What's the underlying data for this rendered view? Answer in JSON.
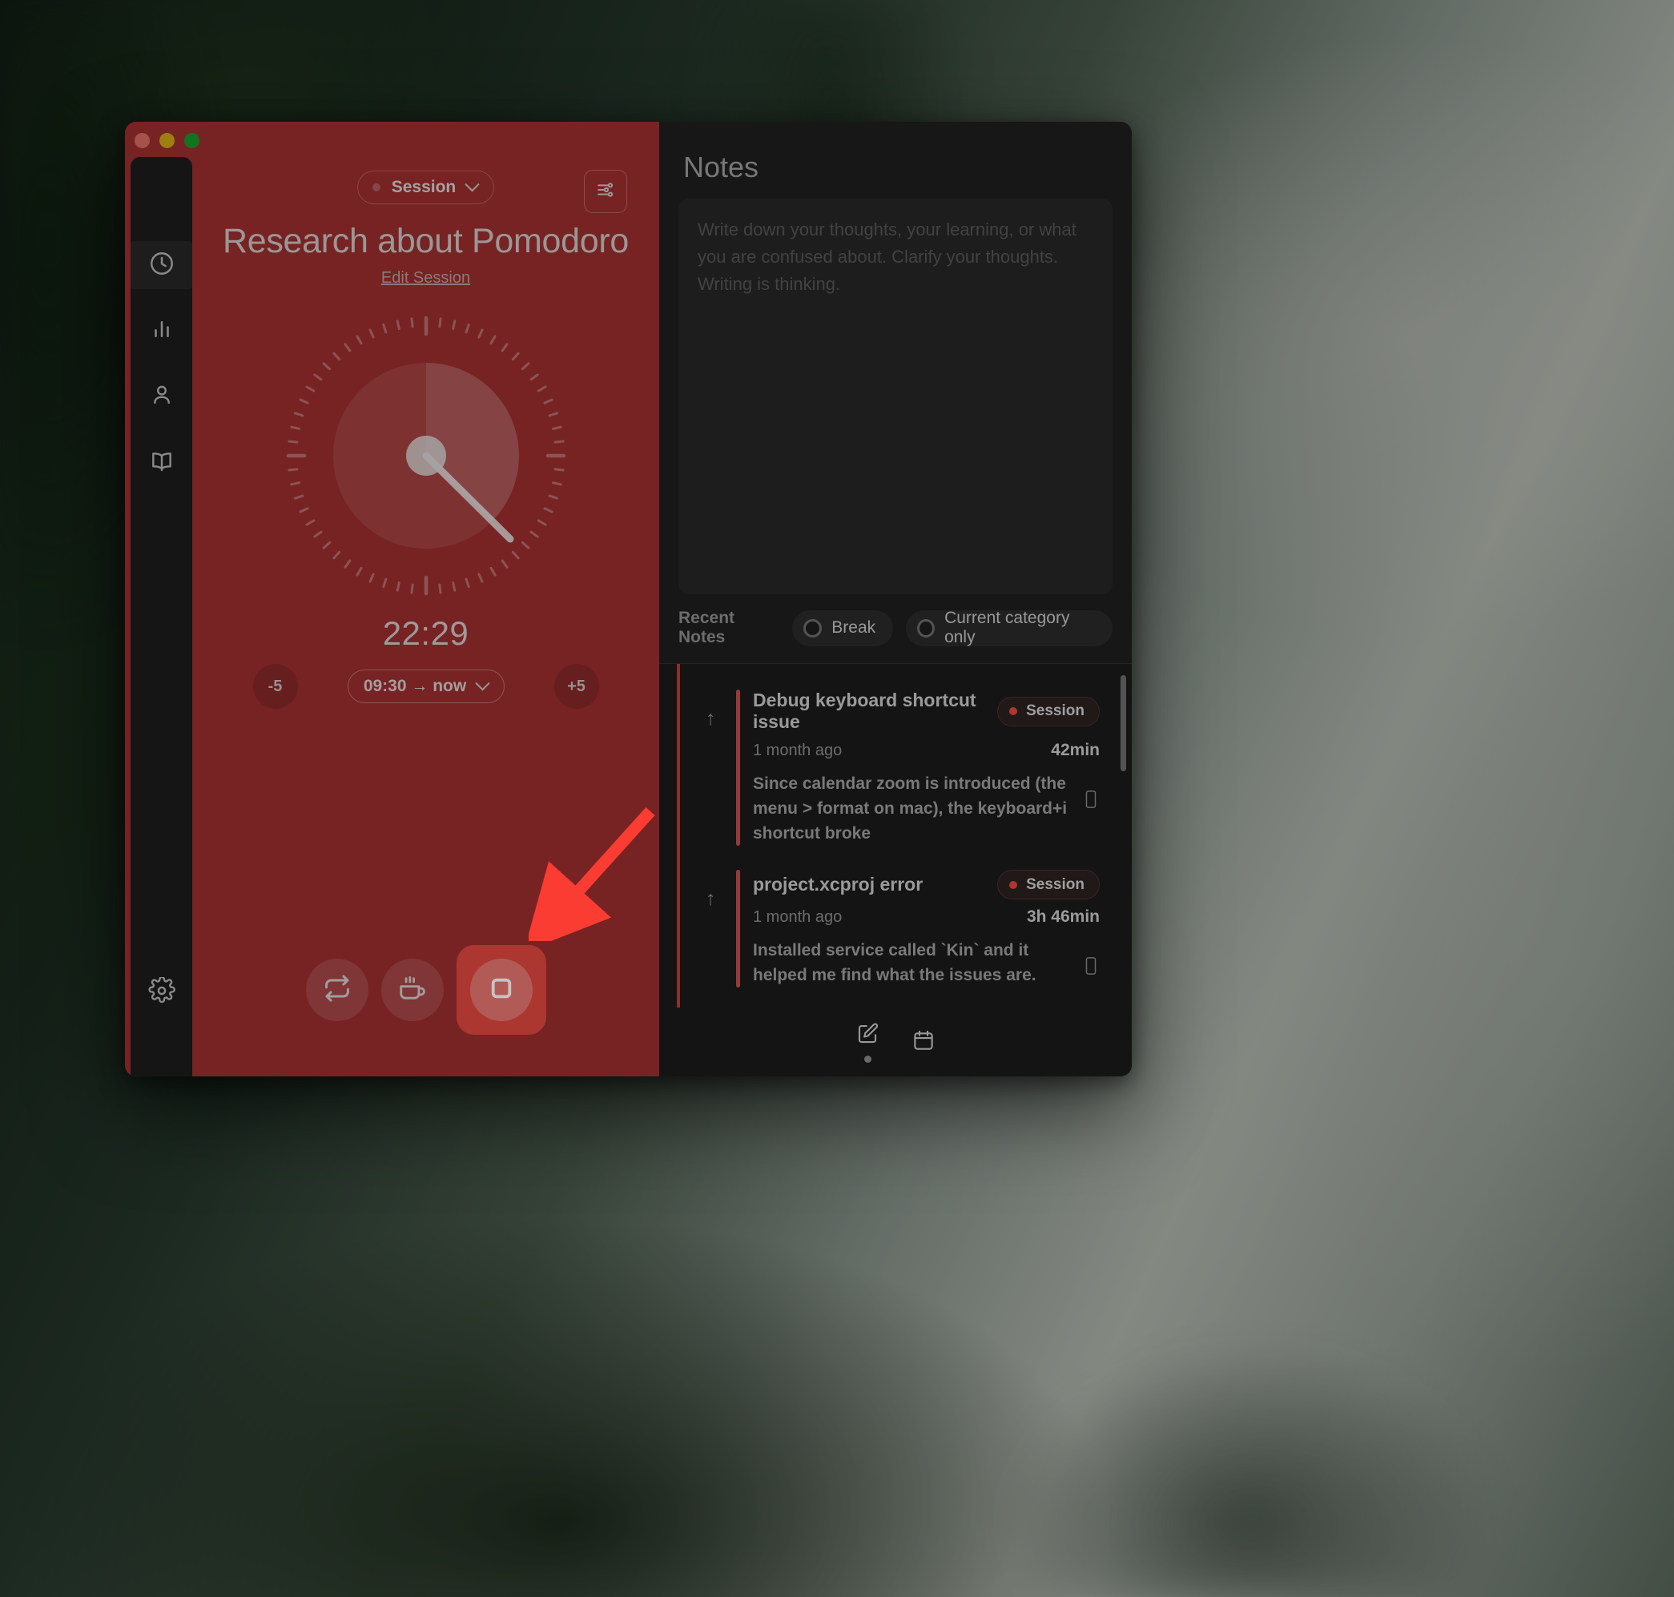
{
  "window": {
    "traffic_lights": [
      "close",
      "minimize",
      "zoom"
    ]
  },
  "sidebar": {
    "items": [
      {
        "name": "timer",
        "icon": "clock-icon",
        "active": true
      },
      {
        "name": "stats",
        "icon": "bar-chart-icon",
        "active": false
      },
      {
        "name": "profile",
        "icon": "person-icon",
        "active": false
      },
      {
        "name": "journal",
        "icon": "book-icon",
        "active": false
      }
    ],
    "bottom": {
      "name": "settings",
      "icon": "gear-icon"
    }
  },
  "timer": {
    "category_pill": {
      "label": "Session",
      "dropdown_icon": "chevron-down-icon"
    },
    "settings_icon": "sliders-icon",
    "title": "Research about Pomodoro",
    "edit_link": "Edit Session",
    "elapsed": "22:29",
    "range_label": "09:30 → now",
    "range_dropdown_icon": "chevron-down-icon",
    "minus_label": "-5",
    "plus_label": "+5",
    "actions": [
      {
        "name": "repeat-button",
        "icon": "repeat-icon"
      },
      {
        "name": "break-button",
        "icon": "coffee-icon"
      },
      {
        "name": "stop-button",
        "icon": "stop-square-icon"
      }
    ],
    "colors": {
      "pane_background": "#9b2e2e",
      "stop_button": "#e0483f"
    },
    "dial": {
      "progress_fraction": 0.375,
      "hand_angle_degrees": 141
    }
  },
  "notes": {
    "heading": "Notes",
    "editor_placeholder": "Write down your thoughts, your learning, or what you are confused about. Clarify your thoughts. Writing is thinking.",
    "filter_label": "Recent Notes",
    "filters": [
      {
        "label": "Break",
        "checked": false
      },
      {
        "label": "Current category only",
        "checked": false
      }
    ],
    "items": [
      {
        "title": "Debug keyboard shortcut issue",
        "badge": "Session",
        "time_ago": "1 month ago",
        "duration": "42min",
        "body": "Since calendar zoom is introduced (the menu > format on mac), the keyboard+i shortcut broke",
        "arrow_icon": "arrow-up-icon",
        "copy_icon": "copy-icon"
      },
      {
        "title": "project.xcproj error",
        "badge": "Session",
        "time_ago": "1 month ago",
        "duration": "3h 46min",
        "body": "Installed service called `Kin` and it helped me find what the issues are.",
        "arrow_icon": "arrow-up-icon",
        "copy_icon": "copy-icon"
      }
    ],
    "footer_actions": [
      {
        "name": "new-note-button",
        "icon": "edit-square-icon",
        "has_dot": true
      },
      {
        "name": "calendar-button",
        "icon": "calendar-icon",
        "has_dot": false
      }
    ],
    "colors": {
      "pane_background": "#1f1f1f",
      "accent": "#b4403c"
    }
  },
  "annotation": {
    "arrow_color": "#fa3c32",
    "points_at": "stop-button"
  }
}
